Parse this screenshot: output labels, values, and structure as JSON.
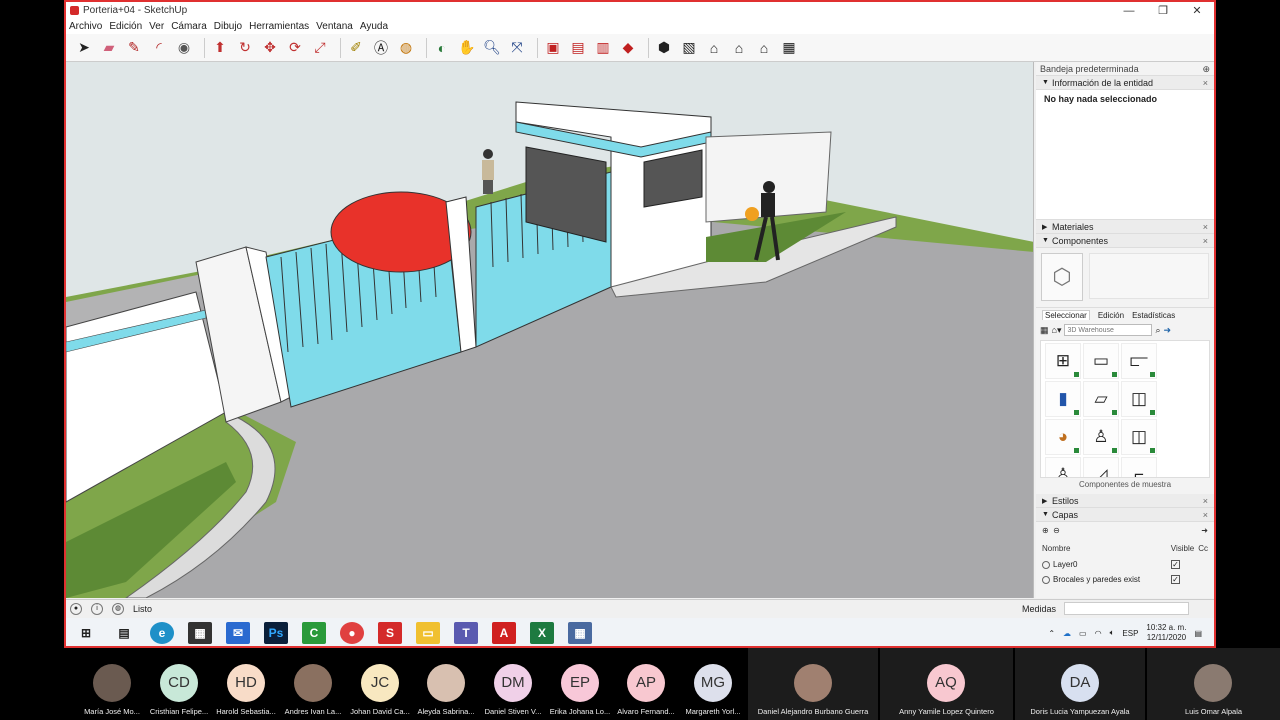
{
  "window": {
    "title": "Porteria+04 - SketchUp",
    "minimize": "—",
    "maximize": "❐",
    "close": "✕"
  },
  "menu": [
    "Archivo",
    "Edición",
    "Ver",
    "Cámara",
    "Dibujo",
    "Herramientas",
    "Ventana",
    "Ayuda"
  ],
  "tray": {
    "title": "Bandeja predeterminada",
    "pin": "⊕",
    "entity_info": {
      "label": "Información de la entidad",
      "message": "No hay nada seleccionado"
    },
    "materials": "Materiales",
    "components": {
      "label": "Componentes",
      "tabs": [
        "Seleccionar",
        "Edición",
        "Estadísticas"
      ],
      "search_placeholder": "3D Warehouse",
      "footer": "Componentes de muestra"
    },
    "styles": "Estilos",
    "layers": {
      "label": "Capas",
      "col_name": "Nombre",
      "col_visible": "Visible",
      "col_color": "Cc",
      "rows": [
        {
          "name": "Layer0",
          "visible": "✓"
        },
        {
          "name": "Brocales y paredes exist",
          "visible": "✓"
        }
      ]
    }
  },
  "status": {
    "text": "Listo",
    "measures_label": "Medidas"
  },
  "taskbar": {
    "lang": "ESP",
    "time": "10:32 a. m.",
    "date": "12/11/2020"
  },
  "participants": [
    {
      "initials": "",
      "name": "María José Mo..."
    },
    {
      "initials": "CD",
      "name": "Cristhian Felipe..."
    },
    {
      "initials": "HD",
      "name": "Harold Sebastia..."
    },
    {
      "initials": "",
      "name": "Andres Ivan La..."
    },
    {
      "initials": "JC",
      "name": "Johan David Ca..."
    },
    {
      "initials": "",
      "name": "Aleyda Sabrina..."
    },
    {
      "initials": "DM",
      "name": "Daniel Stiven V..."
    },
    {
      "initials": "EP",
      "name": "Erika Johana Lo..."
    },
    {
      "initials": "AP",
      "name": "Alvaro Fernand..."
    },
    {
      "initials": "MG",
      "name": "Margareth Yorl..."
    },
    {
      "initials": "",
      "name": "Daniel Alejandro Burbano Guerra"
    },
    {
      "initials": "AQ",
      "name": "Anny Yamile Lopez Quintero"
    },
    {
      "initials": "DA",
      "name": "Doris Lucia Yampuezan Ayala"
    },
    {
      "initials": "",
      "name": "Luis Omar Alpala"
    }
  ],
  "colors": {
    "accent_border": "#e03030",
    "cyan_walls": "#7fdbea",
    "grass": "#5d8a35"
  }
}
